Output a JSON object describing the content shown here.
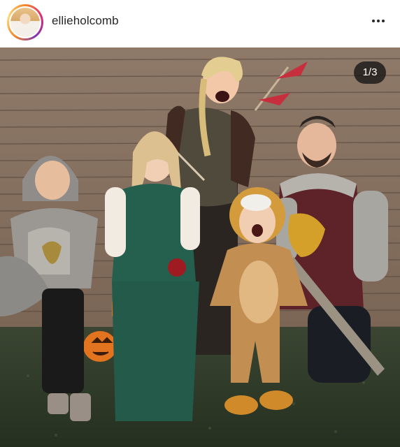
{
  "header": {
    "username": "ellieholcomb",
    "avatar_icon": "profile-avatar",
    "more_icon": "more-options-icon"
  },
  "carousel": {
    "counter": "1/3",
    "current": 1,
    "total": 3
  },
  "photo": {
    "icon": "photo"
  },
  "colors": {
    "story_ring": [
      "#f58529",
      "#dd2a7b",
      "#8134af"
    ],
    "counter_bg": "#1c1c1c",
    "fence": "#8a7564",
    "grass": "#2f3a29"
  }
}
